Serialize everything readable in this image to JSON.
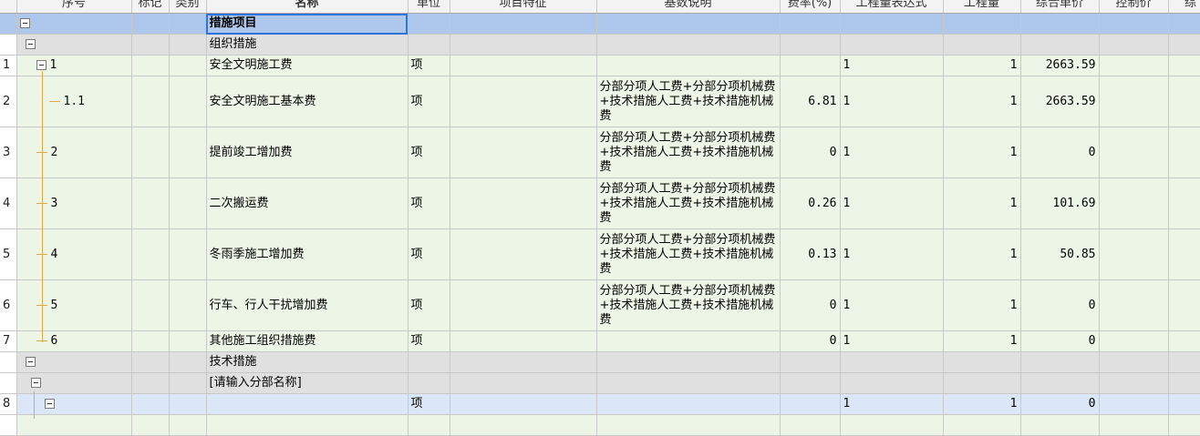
{
  "columns": [
    "序号",
    "标记",
    "类别",
    "名称",
    "单位",
    "项目特征",
    "基数说明",
    "费率(%)",
    "工程量表达式",
    "工程量",
    "综合单价",
    "控制价",
    "综"
  ],
  "rows": [
    {
      "rn": "",
      "code": "",
      "name": "措施项目",
      "unit": "",
      "basis": "",
      "rate": "",
      "expr": "",
      "qty": "",
      "price": ""
    },
    {
      "rn": "",
      "code": "",
      "name": "组织措施",
      "unit": "",
      "basis": "",
      "rate": "",
      "expr": "",
      "qty": "",
      "price": ""
    },
    {
      "rn": "1",
      "code": "1",
      "name": "安全文明施工费",
      "unit": "项",
      "basis": "",
      "rate": "",
      "expr": "1",
      "qty": "1",
      "price": "2663.59"
    },
    {
      "rn": "2",
      "code": "1.1",
      "name": "安全文明施工基本费",
      "unit": "项",
      "basis": "分部分项人工费+分部分项机械费+技术措施人工费+技术措施机械费",
      "rate": "6.81",
      "expr": "1",
      "qty": "1",
      "price": "2663.59"
    },
    {
      "rn": "3",
      "code": "2",
      "name": "提前竣工增加费",
      "unit": "项",
      "basis": "分部分项人工费+分部分项机械费+技术措施人工费+技术措施机械费",
      "rate": "0",
      "expr": "1",
      "qty": "1",
      "price": "0"
    },
    {
      "rn": "4",
      "code": "3",
      "name": "二次搬运费",
      "unit": "项",
      "basis": "分部分项人工费+分部分项机械费+技术措施人工费+技术措施机械费",
      "rate": "0.26",
      "expr": "1",
      "qty": "1",
      "price": "101.69"
    },
    {
      "rn": "5",
      "code": "4",
      "name": "冬雨季施工增加费",
      "unit": "项",
      "basis": "分部分项人工费+分部分项机械费+技术措施人工费+技术措施机械费",
      "rate": "0.13",
      "expr": "1",
      "qty": "1",
      "price": "50.85"
    },
    {
      "rn": "6",
      "code": "5",
      "name": "行车、行人干扰增加费",
      "unit": "项",
      "basis": "分部分项人工费+分部分项机械费+技术措施人工费+技术措施机械费",
      "rate": "0",
      "expr": "1",
      "qty": "1",
      "price": "0"
    },
    {
      "rn": "7",
      "code": "6",
      "name": "其他施工组织措施费",
      "unit": "项",
      "basis": "",
      "rate": "0",
      "expr": "1",
      "qty": "1",
      "price": "0"
    },
    {
      "rn": "",
      "code": "",
      "name": "技术措施",
      "unit": "",
      "basis": "",
      "rate": "",
      "expr": "",
      "qty": "",
      "price": ""
    },
    {
      "rn": "",
      "code": "",
      "name": "[请输入分部名称]",
      "unit": "",
      "basis": "",
      "rate": "",
      "expr": "",
      "qty": "",
      "price": ""
    },
    {
      "rn": "8",
      "code": "",
      "name": "",
      "unit": "项",
      "basis": "",
      "rate": "",
      "expr": "1",
      "qty": "1",
      "price": "0"
    }
  ],
  "colors": {
    "header_row": "#adc8ec",
    "group_row": "#e0e0e0",
    "item_row": "#ecf5e6",
    "selected_row": "#dbe6f7",
    "tree_line": "#e0a84a"
  },
  "icons": {
    "collapse": "collapse-icon"
  }
}
